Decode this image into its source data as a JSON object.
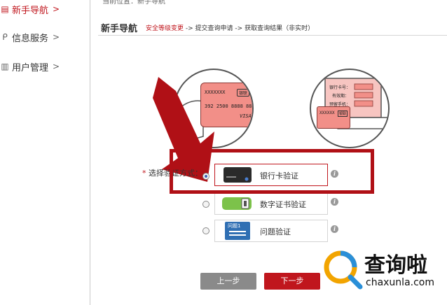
{
  "location": "当前位置：新手导航",
  "sidebar": {
    "items": [
      {
        "icon": "book-icon",
        "label": "新手导航",
        "arrow": ">"
      },
      {
        "icon": "pin-icon",
        "label": "信息服务",
        "arrow": ">"
      },
      {
        "icon": "document-icon",
        "label": "用户管理",
        "arrow": ">"
      }
    ]
  },
  "header": {
    "title": "新手导航",
    "step1": "安全等级变更",
    "step2": "-> 提交查询申请",
    "step3": "-> 获取查询结果（非实时）"
  },
  "illustration1": {
    "line1": "XXXXXXX",
    "logo": "银联",
    "line2": "392 2500 8888 888",
    "brand": "VISA"
  },
  "illustration2": {
    "field1": "银行卡号：",
    "field2": "有效期：",
    "field3": "预留手机：",
    "card": "XXXXXX",
    "card_logo": "银联"
  },
  "form": {
    "label_star": "*",
    "label": "选择验证方式：",
    "options": [
      {
        "label": "银行卡验证",
        "selected": true
      },
      {
        "label": "数字证书验证",
        "selected": false
      },
      {
        "label": "问题验证",
        "selected": false
      }
    ],
    "question_icon_text": "问题1",
    "info_glyph": "i"
  },
  "buttons": {
    "prev": "上一步",
    "next": "下一步"
  },
  "watermark": {
    "cn": "查询啦",
    "en": "chaxunla.com"
  },
  "colors": {
    "accent": "#c0161d",
    "highlight": "#b01016",
    "radio_checked": "#3b5fb5"
  }
}
